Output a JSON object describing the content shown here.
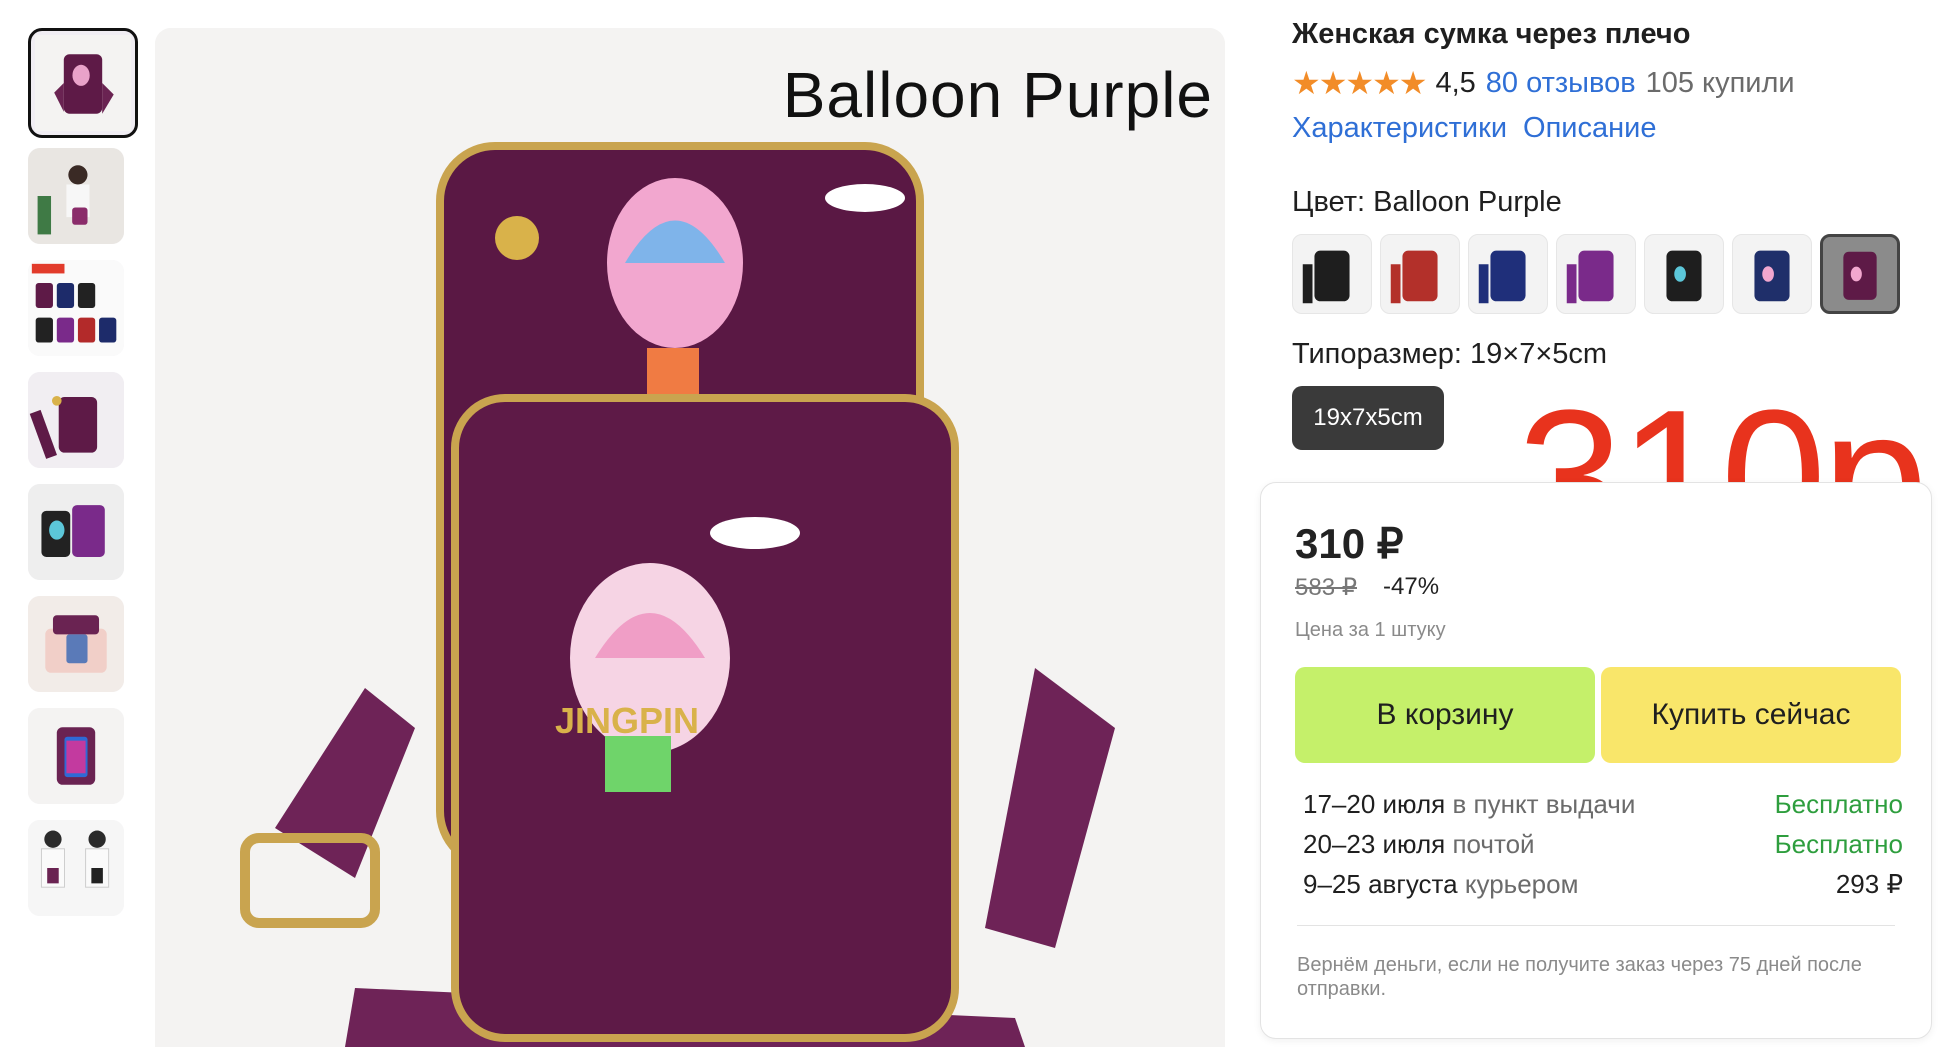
{
  "product": {
    "title": "Женская сумка через плечо",
    "rating_stars": "★★★★★",
    "rating": "4,5",
    "reviews": "80 отзывов",
    "bought": "105 купили",
    "main_caption": "Balloon Purple"
  },
  "tabs": [
    "Характеристики",
    "Описание"
  ],
  "color": {
    "label": "Цвет: Balloon Purple",
    "options": [
      "Black",
      "Red",
      "Blue",
      "Purple",
      "Black Balloon",
      "Balloon Blue",
      "Balloon Purple"
    ],
    "selected_index": 6
  },
  "size": {
    "label": "Типоразмер: 19×7×5cm",
    "chip": "19x7x5cm"
  },
  "promo_price": "310р",
  "buy_box": {
    "price": "310 ₽",
    "old_price": "583 ₽",
    "discount": "-47%",
    "unit_note": "Цена за 1 штуку",
    "cart_button": "В корзину",
    "buy_button": "Купить сейчас",
    "delivery": [
      {
        "dates": "17–20 июля",
        "method": "в пункт выдачи",
        "cost": "Бесплатно",
        "free": true
      },
      {
        "dates": "20–23 июля",
        "method": "почтой",
        "cost": "Бесплатно",
        "free": true
      },
      {
        "dates": "9–25 августа",
        "method": "курьером",
        "cost": "293 ₽",
        "free": false
      }
    ],
    "refund_note": "Вернём деньги, если не получите заказ через 75 дней после отправки."
  },
  "colors": {
    "bag_purple": "#5e1a47",
    "price_red": "#e8331d",
    "link_blue": "#2f6fd6",
    "star_orange": "#f28c28",
    "cart_green": "#c5f06a",
    "buy_yellow": "#f9e66a",
    "free_green": "#2e9e3e"
  }
}
